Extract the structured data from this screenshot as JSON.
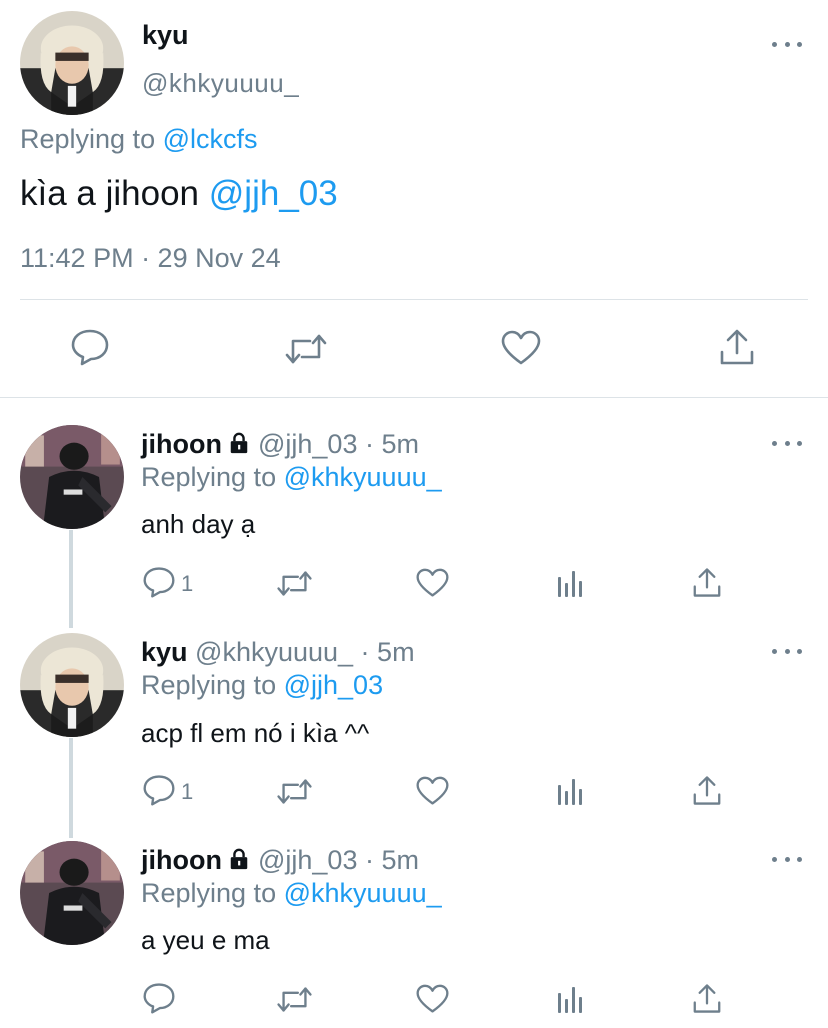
{
  "main_tweet": {
    "name": "kyu",
    "handle": "@khkyuuuu_",
    "replying_prefix": "Replying to",
    "replying_to": "@lckcfs",
    "text": "kìa a jihoon",
    "mention": "@jjh_03",
    "timestamp": "11:42 PM · 29 Nov 24",
    "actions": [
      "reply-icon",
      "retweet-icon",
      "like-icon",
      "share-icon"
    ]
  },
  "replies": [
    {
      "name": "jihoon",
      "locked": true,
      "meta": "@jjh_03 · 5m",
      "replying_prefix": "Replying to",
      "replying_to": "@khkyuuuu_",
      "text": "anh day ạ",
      "reply_count": "1"
    },
    {
      "name": "kyu",
      "locked": false,
      "meta": "@khkyuuuu_ · 5m",
      "replying_prefix": "Replying to",
      "replying_to": "@jjh_03",
      "text": "acp fl em nó i kìa ^^",
      "reply_count": "1"
    },
    {
      "name": "jihoon",
      "locked": true,
      "meta": "@jjh_03 · 5m",
      "replying_prefix": "Replying to",
      "replying_to": "@khkyuuuu_",
      "text": "a yeu e ma",
      "reply_count": ""
    }
  ],
  "colors": {
    "accent": "#1d9bf0",
    "muted": "#6e7f8c",
    "text": "#0f1419",
    "divider": "#dde3e7"
  }
}
